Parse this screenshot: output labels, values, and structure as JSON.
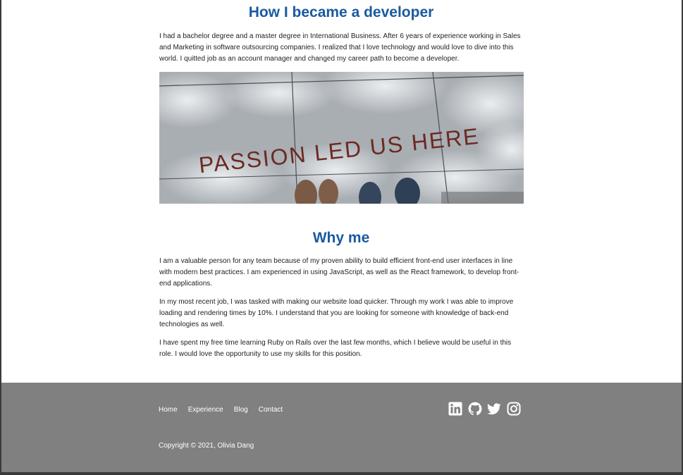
{
  "section_developer": {
    "title": "How I became a developer",
    "paragraph": "I had a bachelor degree and a master degree in International Business. After 6 years of experience working in Sales and Marketing in software outsourcing companies. I realized that I love technology and would love to dive into this world. I quitted job as an account manager and changed my career path to become a developer.",
    "image": {
      "overlay_text": "PASSION LED US HERE"
    }
  },
  "section_why": {
    "title": "Why me",
    "paragraphs": [
      "I am a valuable person for any team because of my proven ability to build efficient front-end user interfaces in line with modern best practices. I am experienced in using JavaScript, as well as the React framework, to develop front-end applications.",
      "In my most recent job, I was tasked with making our website load quicker. Through my work I was able to improve loading and rendering times by 10%. I understand that you are looking for someone with knowledge of back-end technologies as well.",
      "I have spent my free time learning Ruby on Rails over the last few months, which I believe would be useful in this role. I would love the opportunity to use my skills for this position."
    ]
  },
  "footer": {
    "nav": [
      "Home",
      "Experience",
      "Blog",
      "Contact"
    ],
    "social_icons": [
      "linkedin-icon",
      "github-icon",
      "twitter-icon",
      "instagram-icon"
    ],
    "copyright": "Copyright © 2021, Olivia Dang"
  },
  "colors": {
    "heading": "#1a5aa0",
    "footer_bg": "#808080",
    "footer_text": "#ffffff"
  }
}
